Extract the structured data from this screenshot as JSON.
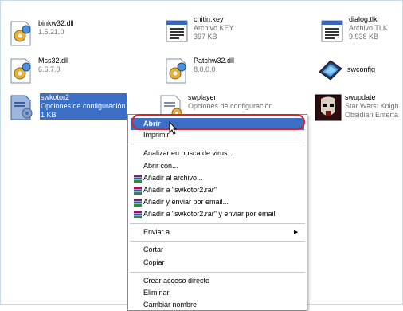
{
  "files": [
    {
      "name": "binkw32.dll",
      "line2": "1.5.21.0",
      "line3": "",
      "icon": "dll-gear-icon"
    },
    {
      "name": "chitin.key",
      "line2": "Archivo KEY",
      "line3": "397 KB",
      "icon": "key-file-icon"
    },
    {
      "name": "dialog.tlk",
      "line2": "Archivo TLK",
      "line3": "9.938 KB",
      "icon": "tlk-file-icon"
    },
    {
      "name": "Mss32.dll",
      "line2": "6.6.7.0",
      "line3": "",
      "icon": "dll-gear-icon"
    },
    {
      "name": "Patchw32.dll",
      "line2": "8.0.0.0",
      "line3": "",
      "icon": "dll-gear-icon"
    },
    {
      "name": "swconfig",
      "line2": "",
      "line3": "",
      "icon": "monitor-config-icon"
    },
    {
      "name": "swkotor2",
      "line2": "Opciones de configuración",
      "line3": "1 KB",
      "icon": "config-file-icon"
    },
    {
      "name": "swplayer",
      "line2": "Opciones de configuración",
      "line3": "",
      "icon": "config-file-icon"
    },
    {
      "name": "swupdate",
      "line2": "Star Wars: Knigh",
      "line3": "Obsidian Enterta",
      "icon": "sith-mask-icon"
    }
  ],
  "menu": {
    "abrir": "Abrir",
    "imprimir": "Imprimir",
    "antivirus": "Analizar en busca de virus...",
    "abrir_con": "Abrir con...",
    "rar1": "Añadir al archivo...",
    "rar2": "Añadir a \"swkotor2.rar\"",
    "rar3": "Añadir y enviar por email...",
    "rar4": "Añadir a \"swkotor2.rar\" y enviar por email",
    "enviar": "Enviar a",
    "cortar": "Cortar",
    "copiar": "Copiar",
    "acceso": "Crear acceso directo",
    "eliminar": "Eliminar",
    "renombrar": "Cambiar nombre"
  },
  "colors": {
    "selection": "#3a6fc5",
    "highlight_ring": "#d82424"
  }
}
